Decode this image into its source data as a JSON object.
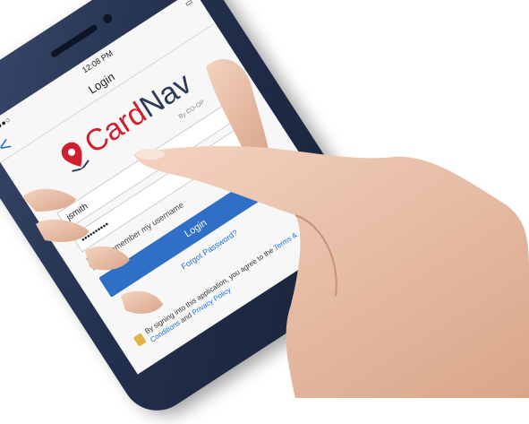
{
  "phone": {
    "status_time": "12:08 PM",
    "nav_title": "Login",
    "back_label": "<",
    "logo_brand_primary": "Card",
    "logo_brand_secondary": "Nav",
    "logo_byline": "By CO-OP",
    "username_value": "jsmith",
    "password_value": "••••••••••",
    "remember_label": "Remember my username",
    "remember_checked": "✓",
    "login_button": "Login",
    "forgot_link": "Forgot Password?",
    "terms_prefix": "By signing into this application, you agree to the",
    "terms_link": "Terms & Conditions",
    "terms_and": "and",
    "privacy_link": "Privacy Policy"
  },
  "colors": {
    "brand_red": "#d01f2e",
    "brand_navy": "#2d3a55",
    "button_blue": "#2f6fc6",
    "phone_body": "#2a3653"
  }
}
